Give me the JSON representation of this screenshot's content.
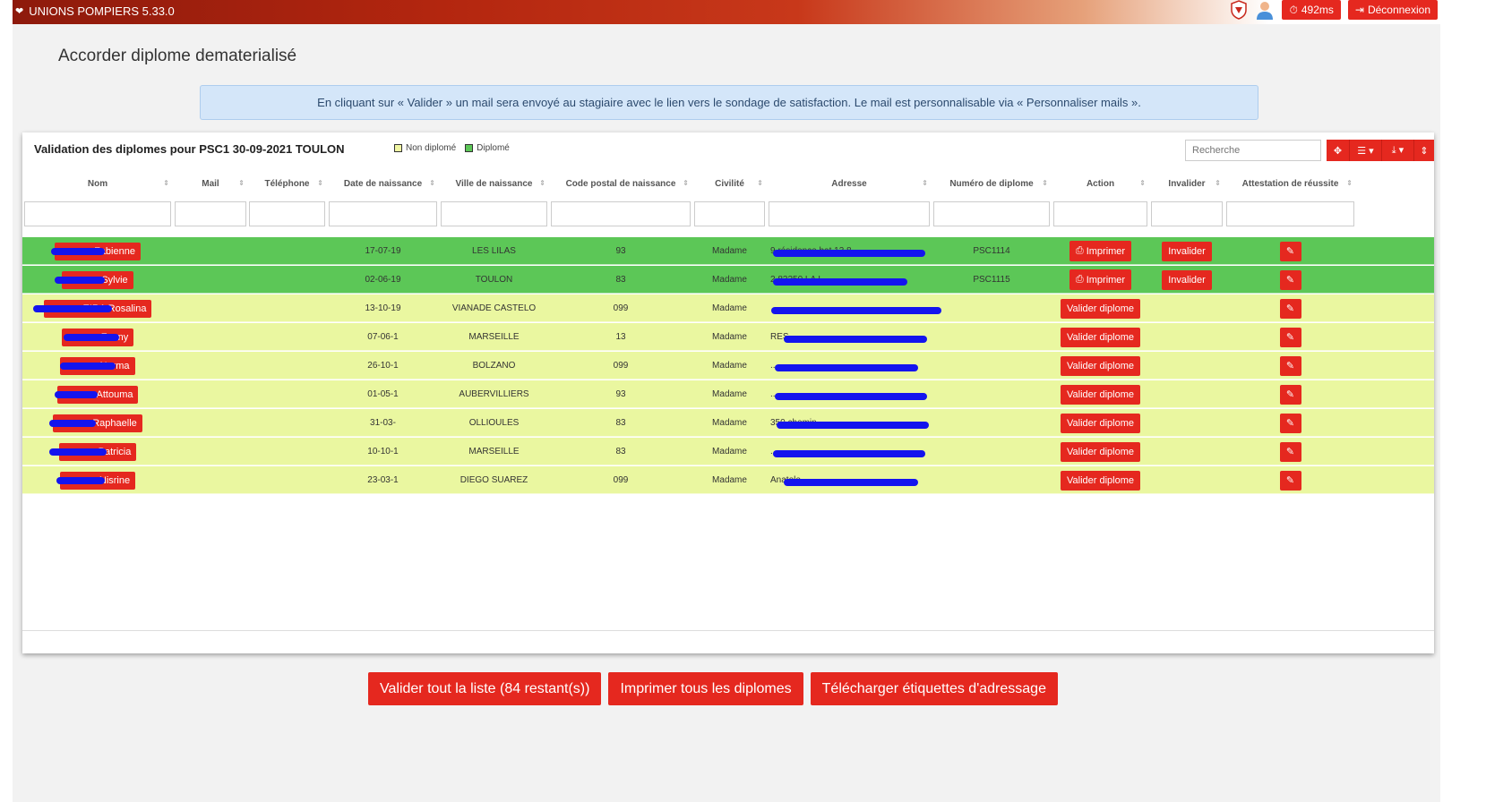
{
  "app": {
    "title": "UNIONS POMPIERS 5.33.0"
  },
  "topbar": {
    "timing": "492ms",
    "logout": "Déconnexion"
  },
  "page": {
    "title": "Accorder diplome dematerialisé"
  },
  "alert": "En cliquant sur « Valider » un mail sera envoyé au stagiaire avec le lien vers le sondage de satisfaction. Le mail est personnalisable via « Personnaliser mails ».",
  "panel": {
    "title": "Validation des diplomes pour PSC1 30-09-2021 TOULON",
    "legend": {
      "not_diplomed": "Non diplomé",
      "diplomed": "Diplomé"
    },
    "search_placeholder": "Recherche"
  },
  "columns": [
    "Nom",
    "Mail",
    "Téléphone",
    "Date de naissance",
    "Ville de naissance",
    "Code postal de naissance",
    "Civilité",
    "Adresse",
    "Numéro de diplome",
    "Action",
    "Invalider",
    "Attestation de réussite"
  ],
  "buttons": {
    "print": "Imprimer",
    "invalidate": "Invalider",
    "validate": "Valider diplome"
  },
  "rows": [
    {
      "status": "diplome",
      "nom": "Fabienne",
      "date": "17-07-19",
      "ville": "LES LILAS",
      "cp": "93",
      "civilite": "Madame",
      "adresse": "9 résidence bat 13 8...",
      "numero": "PSC1114"
    },
    {
      "status": "diplome",
      "nom": "Sylvie",
      "date": "02-06-19",
      "ville": "TOULON",
      "cp": "83",
      "civilite": "Madame",
      "adresse": "2 83250 LA L...",
      "numero": "PSC1115"
    },
    {
      "status": "non",
      "nom": "EIRA Rosalina",
      "date": "13-10-19",
      "ville": "VIANADE CASTELO",
      "cp": "099",
      "civilite": "Madame",
      "adresse": "",
      "numero": ""
    },
    {
      "status": "non",
      "nom": "Fanny",
      "date": "07-06-1",
      "ville": "MARSEILLE",
      "cp": "13",
      "civilite": "Madame",
      "adresse": "RES",
      "numero": ""
    },
    {
      "status": "non",
      "nom": "Norma",
      "date": "26-10-1",
      "ville": "BOLZANO",
      "cp": "099",
      "civilite": "Madame",
      "adresse": "...",
      "numero": ""
    },
    {
      "status": "non",
      "nom": "Attouma",
      "date": "01-05-1",
      "ville": "AUBERVILLIERS",
      "cp": "93",
      "civilite": "Madame",
      "adresse": "...",
      "numero": ""
    },
    {
      "status": "non",
      "nom": "Raphaelle",
      "date": "31-03-",
      "ville": "OLLIOULES",
      "cp": "83",
      "civilite": "Madame",
      "adresse": "350 chemin",
      "numero": ""
    },
    {
      "status": "non",
      "nom": "Patricia",
      "date": "10-10-1",
      "ville": "MARSEILLE",
      "cp": "83",
      "civilite": "Madame",
      "adresse": "...",
      "numero": ""
    },
    {
      "status": "non",
      "nom": "Nisrine",
      "date": "23-03-1",
      "ville": "DIEGO SUAREZ",
      "cp": "099",
      "civilite": "Madame",
      "adresse": "Anatole",
      "numero": ""
    }
  ],
  "footer_buttons": {
    "validate_all": "Valider tout la liste (84 restant(s))",
    "print_all": "Imprimer tous les diplomes",
    "labels": "Télécharger étiquettes d'adressage"
  }
}
